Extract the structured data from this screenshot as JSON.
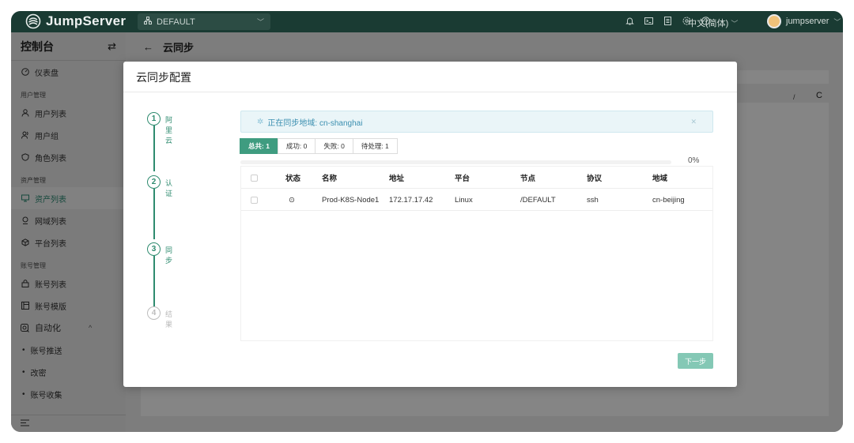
{
  "header": {
    "brand": "JumpServer",
    "org": "DEFAULT",
    "language": "中文(简体)",
    "username": "jumpserver"
  },
  "sidebar": {
    "title": "控制台",
    "groups": [
      {
        "type": "item",
        "label": "仪表盘",
        "icon": "dashboard-icon"
      },
      {
        "type": "group",
        "label": "用户管理"
      },
      {
        "type": "item",
        "label": "用户列表",
        "icon": "user-icon"
      },
      {
        "type": "item",
        "label": "用户组",
        "icon": "users-icon"
      },
      {
        "type": "item",
        "label": "角色列表",
        "icon": "role-icon"
      },
      {
        "type": "group",
        "label": "资产管理"
      },
      {
        "type": "item",
        "label": "资产列表",
        "icon": "asset-icon",
        "active": true
      },
      {
        "type": "item",
        "label": "网域列表",
        "icon": "domain-icon"
      },
      {
        "type": "item",
        "label": "平台列表",
        "icon": "platform-icon"
      },
      {
        "type": "group",
        "label": "账号管理"
      },
      {
        "type": "item",
        "label": "账号列表",
        "icon": "account-icon"
      },
      {
        "type": "item",
        "label": "账号模版",
        "icon": "template-icon"
      },
      {
        "type": "item",
        "label": "自动化",
        "icon": "automation-icon",
        "expand": "^"
      },
      {
        "type": "sub",
        "label": "账号推送"
      },
      {
        "type": "sub",
        "label": "改密"
      },
      {
        "type": "sub",
        "label": "账号收集"
      }
    ]
  },
  "page": {
    "title": "云同步"
  },
  "modal": {
    "title": "云同步配置",
    "steps": [
      {
        "num": "1",
        "label": "阿里云",
        "done": true
      },
      {
        "num": "2",
        "label": "认证",
        "done": true
      },
      {
        "num": "3",
        "label": "同步",
        "done": true
      },
      {
        "num": "4",
        "label": "结果",
        "done": false
      }
    ],
    "alert": "正在同步地域: cn-shanghai",
    "filters": [
      {
        "label": "总共: 1",
        "active": true
      },
      {
        "label": "成功: 0",
        "active": false
      },
      {
        "label": "失败: 0",
        "active": false
      },
      {
        "label": "待处理: 1",
        "active": false
      }
    ],
    "progress": {
      "percent": 0,
      "text": "0%"
    },
    "table": {
      "headers": [
        "状态",
        "名称",
        "地址",
        "平台",
        "节点",
        "协议",
        "地域"
      ],
      "rows": [
        {
          "status": "⊙",
          "name": "Prod-K8S-Node1",
          "address": "172.17.17.42",
          "platform": "Linux",
          "node": "/DEFAULT",
          "protocol": "ssh",
          "region": "cn-beijing"
        }
      ]
    },
    "next_label": "下一步"
  },
  "background": {
    "slash": "/",
    "refresh": "C"
  }
}
